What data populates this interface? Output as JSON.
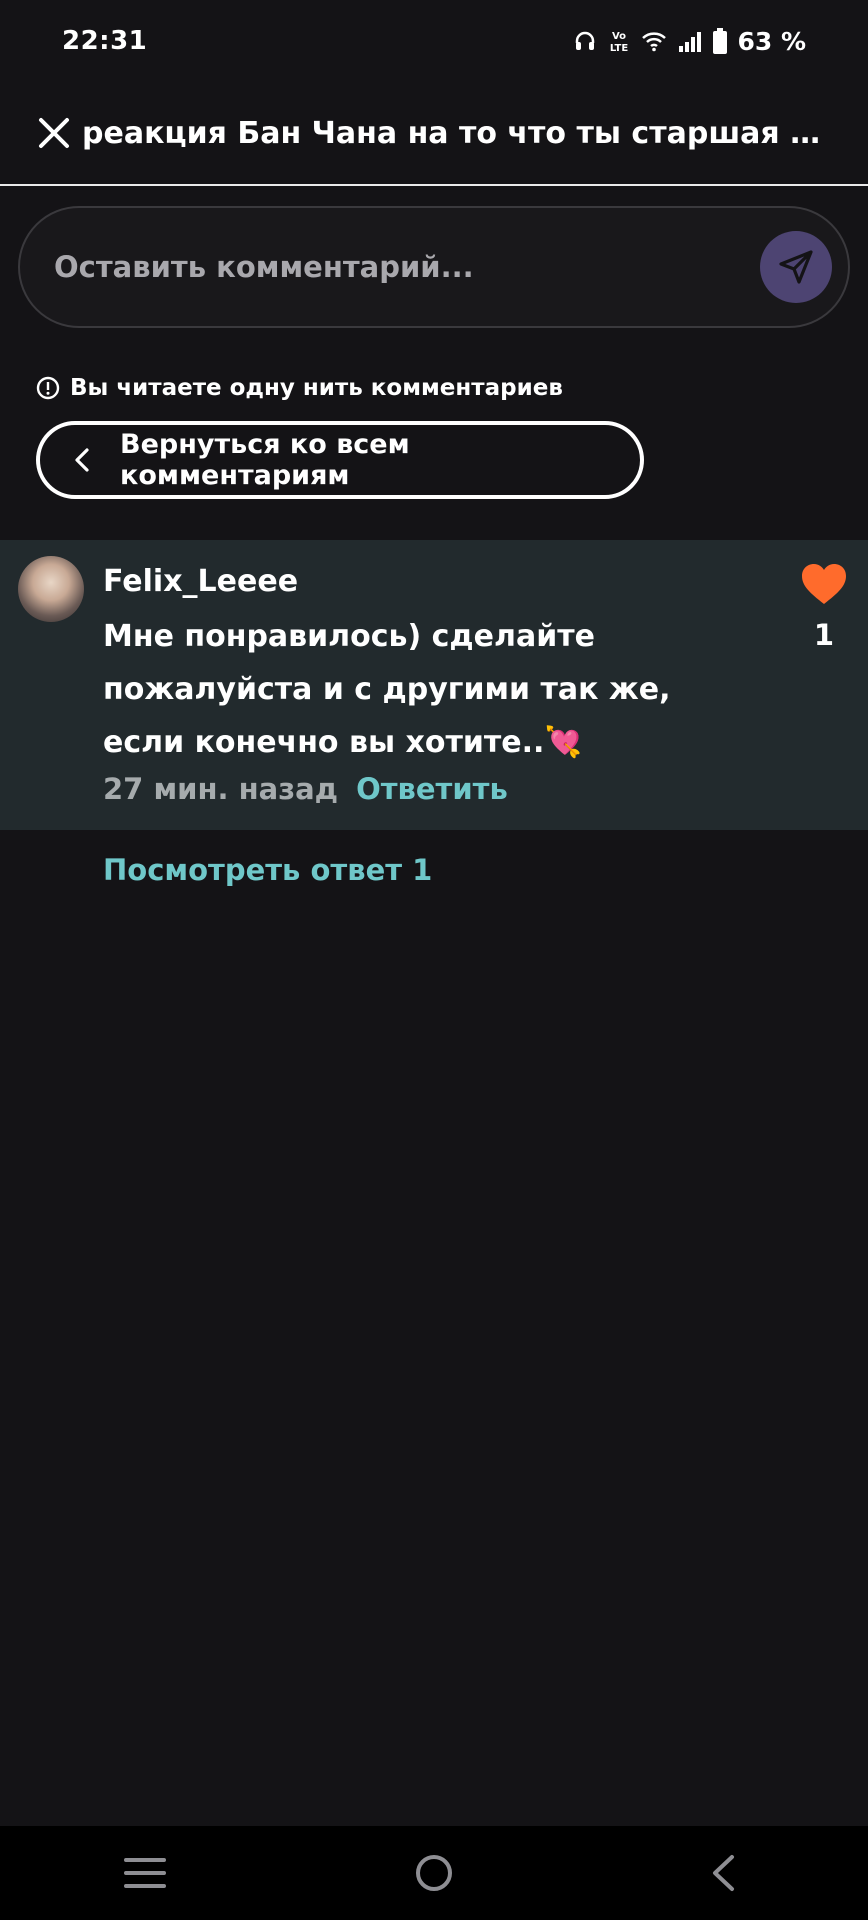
{
  "status_bar": {
    "time": "22:31",
    "battery_label": "63 %"
  },
  "header": {
    "title": "реакция Бан Чана на то что ты старшая с..."
  },
  "comment_box": {
    "placeholder": "Оставить комментарий..."
  },
  "thread": {
    "notice": "Вы читаете одну нить комментариев",
    "back_label": "Вернуться ко всем комментариям"
  },
  "comment": {
    "author": "Felix_Leeee",
    "text": "Мне понравилось) сделайте пожалуйста и с другими так же, если конечно вы хотите..💘",
    "time": "27 мин. назад",
    "reply_label": "Ответить",
    "like_count": "1"
  },
  "view_replies_label": "Посмотреть ответ 1",
  "colors": {
    "background": "#141316",
    "comment_bg": "#222a2d",
    "accent_teal": "#6fc7c9",
    "like_orange": "#ff6b2c",
    "send_button": "#4d4472"
  },
  "icons": [
    "headphones-icon",
    "volte-icon",
    "wifi-icon",
    "signal-icon",
    "battery-icon",
    "close-icon",
    "send-icon",
    "info-icon",
    "chevron-left-icon",
    "heart-icon",
    "menu-icon",
    "home-icon",
    "back-icon"
  ]
}
